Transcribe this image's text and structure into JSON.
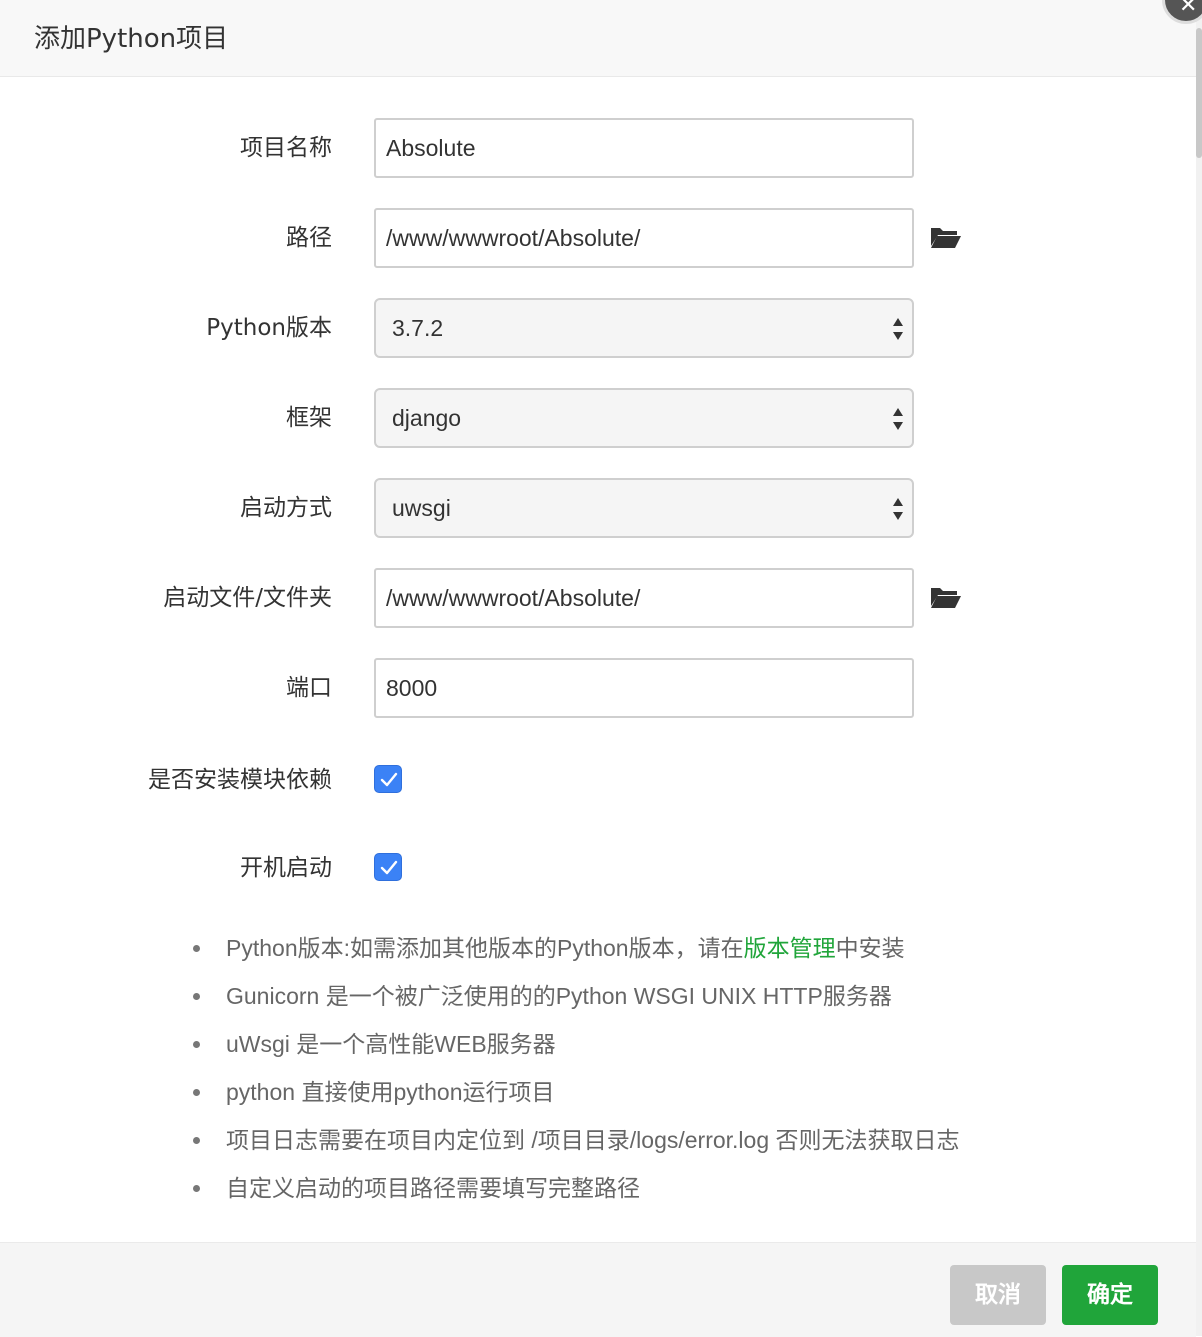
{
  "dialog": {
    "title": "添加Python项目"
  },
  "form": {
    "project_name": {
      "label": "项目名称",
      "value": "Absolute"
    },
    "path": {
      "label": "路径",
      "value": "/www/wwwroot/Absolute/"
    },
    "python_version": {
      "label": "Python版本",
      "value": "3.7.2"
    },
    "framework": {
      "label": "框架",
      "value": "django"
    },
    "start_method": {
      "label": "启动方式",
      "value": "uwsgi"
    },
    "start_file": {
      "label": "启动文件/文件夹",
      "value": "/www/wwwroot/Absolute/"
    },
    "port": {
      "label": "端口",
      "value": "8000"
    },
    "install_deps": {
      "label": "是否安装模块依赖",
      "checked": true
    },
    "autostart": {
      "label": "开机启动",
      "checked": true
    }
  },
  "notes": {
    "n1_prefix": "Python版本:如需添加其他版本的Python版本，请在",
    "n1_link": "版本管理",
    "n1_suffix": "中安装",
    "n2": "Gunicorn 是一个被广泛使用的的Python WSGI UNIX HTTP服务器",
    "n3": "uWsgi 是一个高性能WEB服务器",
    "n4": "python 直接使用python运行项目",
    "n5": "项目日志需要在项目内定位到 /项目目录/logs/error.log 否则无法获取日志",
    "n6": "自定义启动的项目路径需要填写完整路径"
  },
  "footer": {
    "cancel_label": "取消",
    "ok_label": "确定"
  },
  "colors": {
    "accent": "#20a53a",
    "checkbox": "#3b82f6",
    "cancel": "#c8c8c8"
  },
  "icons": {
    "folder": "folder-open-icon",
    "close": "close-icon",
    "select": "select-arrows-icon",
    "check": "checkmark-icon"
  }
}
